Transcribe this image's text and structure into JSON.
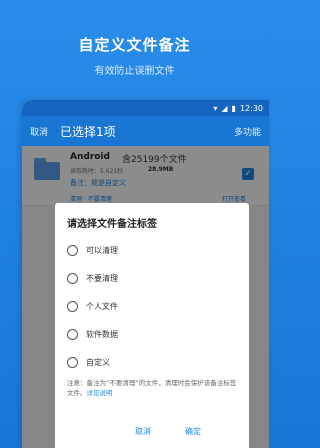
{
  "promo": {
    "title": "自定义文件备注",
    "subtitle": "有效防止误删文件"
  },
  "status_bar": {
    "time": "12:30"
  },
  "app_bar": {
    "cancel": "取消",
    "title": "已选择1项",
    "more": "多功能"
  },
  "file": {
    "name": "Android",
    "count": "含25199个文件",
    "time": "读取耗时：5.621秒",
    "size": "28.9MB",
    "note": "备注：我是自定义",
    "bottom_left": "清理 · 不要清理",
    "bottom_right": "打开查看",
    "checked": true
  },
  "dialog": {
    "title": "请选择文件备注标签",
    "options": [
      {
        "label": "可以清理"
      },
      {
        "label": "不要清理"
      },
      {
        "label": "个人文件"
      },
      {
        "label": "软件数据"
      },
      {
        "label": "自定义"
      }
    ],
    "note_prefix": "注意：备注为“不要清理”的文件，清理时会保护该备注标签文件。",
    "note_link": "详见说明",
    "cancel": "取消",
    "ok": "确定"
  },
  "colors": {
    "background": "#1f7fe0",
    "app_bar": "#1976d2",
    "accent": "#1e88e5"
  }
}
